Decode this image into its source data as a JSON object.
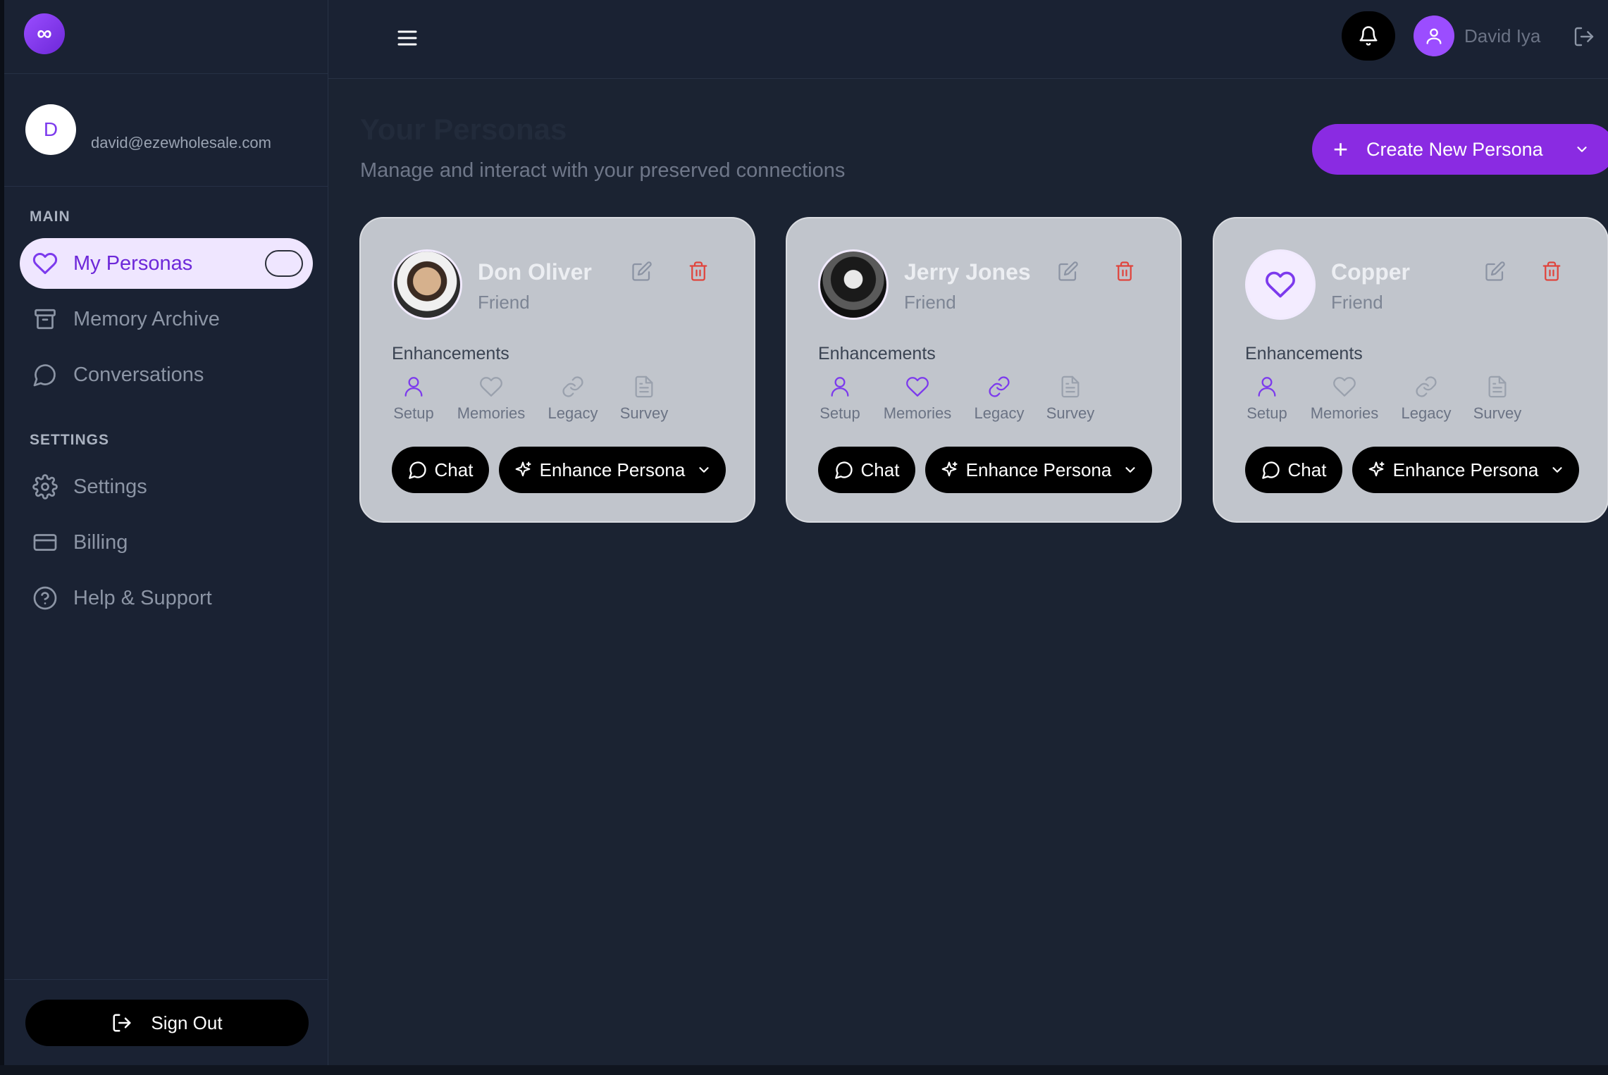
{
  "logo": {
    "glyph": "∞"
  },
  "sidebar": {
    "profile": {
      "initial": "D",
      "email": "david@ezewholesale.com"
    },
    "main_label": "MAIN",
    "settings_label": "SETTINGS",
    "main_items": [
      {
        "label": "My Personas",
        "icon": "heart-icon",
        "active": true
      },
      {
        "label": "Memory Archive",
        "icon": "archive-icon",
        "active": false
      },
      {
        "label": "Conversations",
        "icon": "chat-bubble-icon",
        "active": false
      }
    ],
    "settings_items": [
      {
        "label": "Settings",
        "icon": "gear-icon"
      },
      {
        "label": "Billing",
        "icon": "credit-card-icon"
      },
      {
        "label": "Help & Support",
        "icon": "help-circle-icon"
      }
    ],
    "sign_out_label": "Sign Out"
  },
  "topbar": {
    "user_name": "David Iya"
  },
  "main": {
    "title": "Your Personas",
    "subtitle": "Manage and interact with your preserved connections",
    "create_button_label": "Create New Persona"
  },
  "enhancement_labels": [
    "Setup",
    "Memories",
    "Legacy",
    "Survey"
  ],
  "cards": [
    {
      "name": "Don Oliver",
      "relation": "Friend",
      "avatar": "photo",
      "enhancements_label": "Enhancements",
      "enhancements_active": [
        true,
        false,
        false,
        false
      ],
      "chat_label": "Chat",
      "enhance_label": "Enhance Persona"
    },
    {
      "name": "Jerry Jones",
      "relation": "Friend",
      "avatar": "photo",
      "enhancements_label": "Enhancements",
      "enhancements_active": [
        true,
        true,
        true,
        false
      ],
      "chat_label": "Chat",
      "enhance_label": "Enhance Persona"
    },
    {
      "name": "Copper",
      "relation": "Friend",
      "avatar": "heart-icon",
      "enhancements_label": "Enhancements",
      "enhancements_active": [
        true,
        false,
        false,
        false
      ],
      "chat_label": "Chat",
      "enhance_label": "Enhance Persona"
    }
  ],
  "colors": {
    "accent": "#8a2be2",
    "active_icon": "#7c3aed",
    "inactive_icon": "#9aa1ad",
    "delete": "#e0443c",
    "background": "#1b2332"
  }
}
